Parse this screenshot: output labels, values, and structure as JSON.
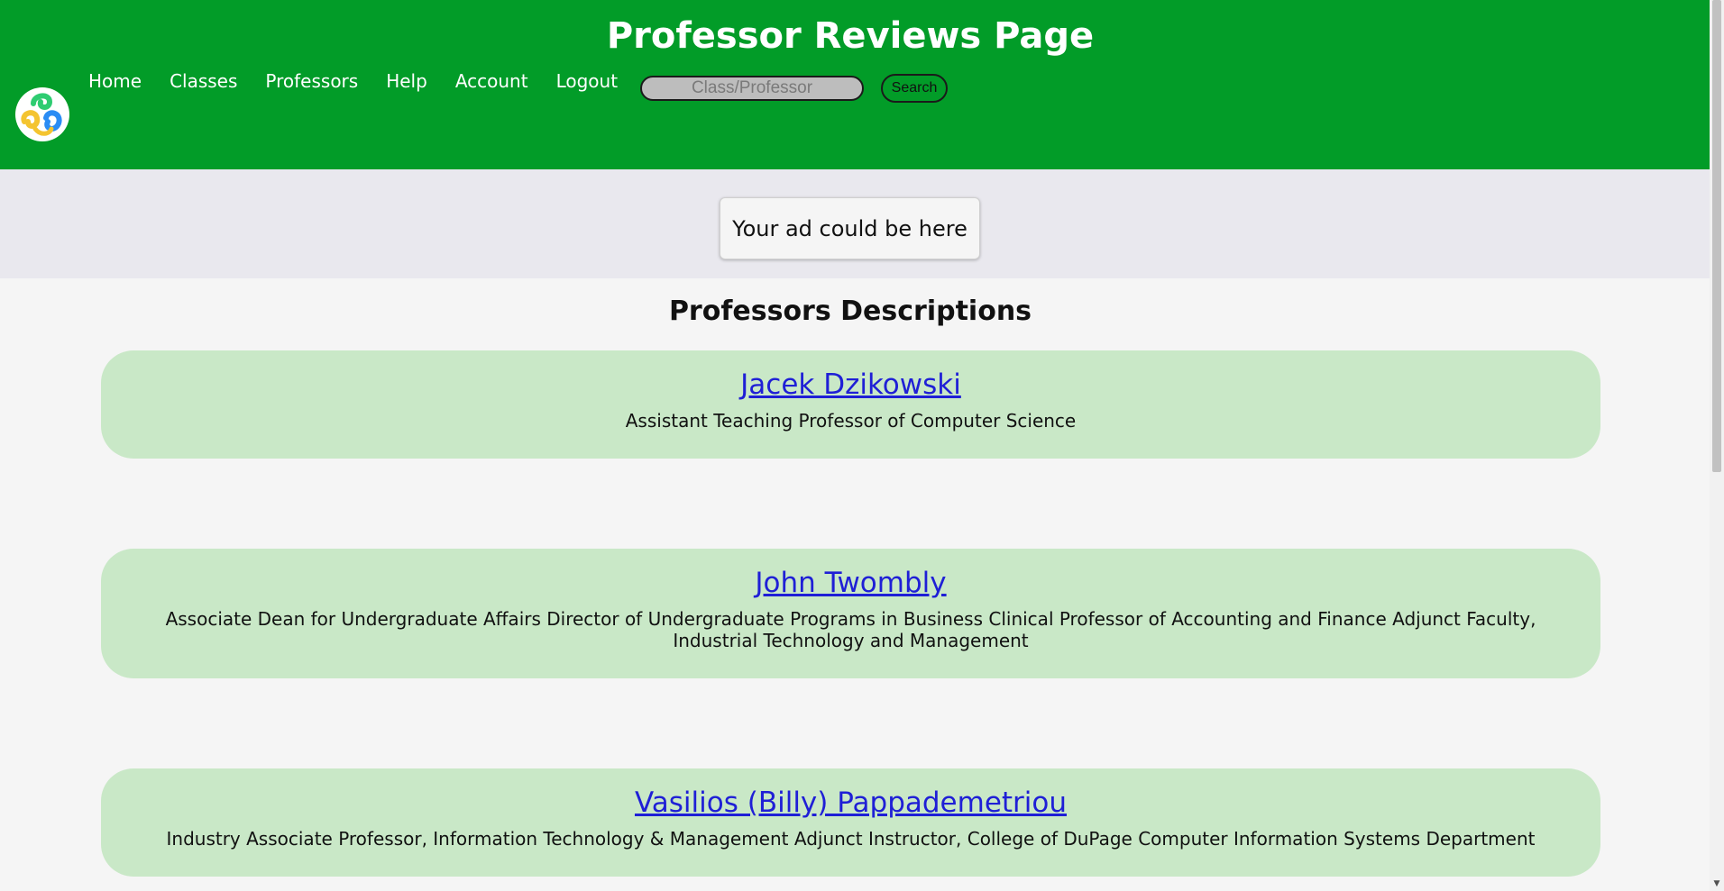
{
  "header": {
    "title": "Professor Reviews Page",
    "nav": [
      "Home",
      "Classes",
      "Professors",
      "Help",
      "Account",
      "Logout"
    ],
    "search": {
      "placeholder": "Class/Professor",
      "value": "",
      "button_label": "Search"
    },
    "colors": {
      "background": "#029c28",
      "text": "#ffffff"
    },
    "logo_icon": "swirl-logo-icon"
  },
  "ad": {
    "text": "Your ad could be here"
  },
  "main": {
    "section_title": "Professors Descriptions",
    "professors": [
      {
        "name": "Jacek Dzikowski",
        "description": "Assistant Teaching Professor of Computer Science"
      },
      {
        "name": "John Twombly",
        "description": "Associate Dean for Undergraduate Affairs Director of Undergraduate Programs in Business Clinical Professor of Accounting and Finance Adjunct Faculty, Industrial Technology and Management"
      },
      {
        "name": "Vasilios (Billy) Pappademetriou",
        "description": "Industry Associate Professor, Information Technology & Management Adjunct Instructor, College of DuPage Computer Information Systems Department"
      }
    ],
    "colors": {
      "card_background": "#c9e8c7",
      "link": "#1f1fd6"
    }
  }
}
